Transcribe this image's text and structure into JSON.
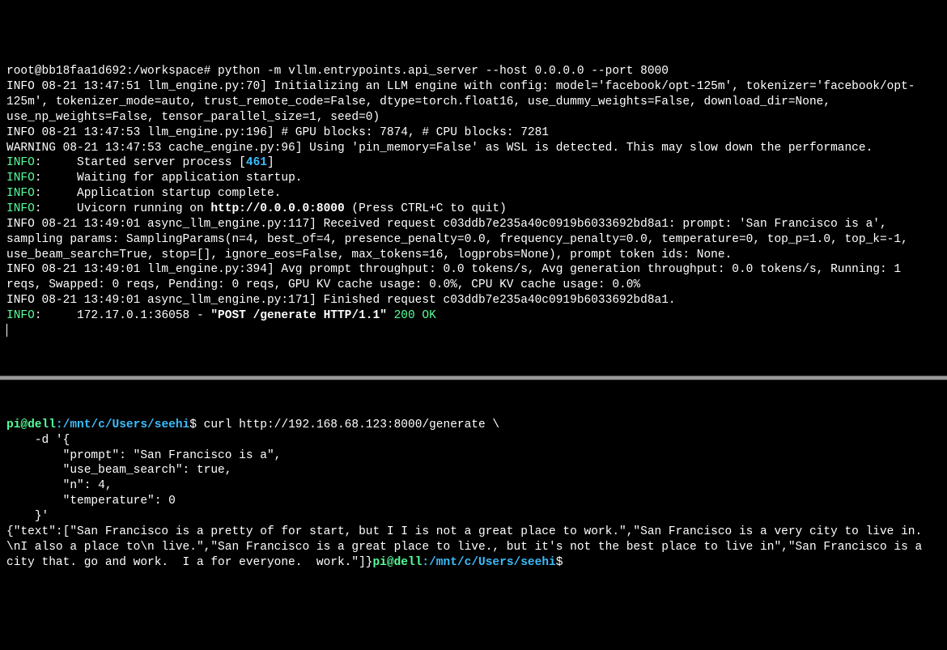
{
  "server": {
    "prompt_root": "root@bb18faa1d692",
    "prompt_path": ":/workspace#",
    "command": " python -m vllm.entrypoints.api_server --host 0.0.0.0 --port 8000",
    "line1": "INFO 08-21 13:47:51 llm_engine.py:70] Initializing an LLM engine with config: model='facebook/opt-125m', tokenizer='facebook/opt-125m', tokenizer_mode=auto, trust_remote_code=False, dtype=torch.float16, use_dummy_weights=False, download_dir=None, use_np_weights=False, tensor_parallel_size=1, seed=0)",
    "line2": "INFO 08-21 13:47:53 llm_engine.py:196] # GPU blocks: 7874, # CPU blocks: 7281",
    "line3": "WARNING 08-21 13:47:53 cache_engine.py:96] Using 'pin_memory=False' as WSL is detected. This may slow down the performance.",
    "info_label": "INFO",
    "colon": ":",
    "pad": "     ",
    "started_pre": "Started server process [",
    "pid": "461",
    "started_post": "]",
    "waiting": "Waiting for application startup.",
    "complete": "Application startup complete.",
    "uvicorn_pre": "Uvicorn running on ",
    "uvicorn_url": "http://0.0.0.0:8000",
    "uvicorn_post": " (Press CTRL+C to quit)",
    "line4": "INFO 08-21 13:49:01 async_llm_engine.py:117] Received request c03ddb7e235a40c0919b6033692bd8a1: prompt: 'San Francisco is a', sampling params: SamplingParams(n=4, best_of=4, presence_penalty=0.0, frequency_penalty=0.0, temperature=0, top_p=1.0, top_k=-1, use_beam_search=True, stop=[], ignore_eos=False, max_tokens=16, logprobs=None), prompt token ids: None.",
    "line5": "INFO 08-21 13:49:01 llm_engine.py:394] Avg prompt throughput: 0.0 tokens/s, Avg generation throughput: 0.0 tokens/s, Running: 1 reqs, Swapped: 0 reqs, Pending: 0 reqs, GPU KV cache usage: 0.0%, CPU KV cache usage: 0.0%",
    "line6": "INFO 08-21 13:49:01 async_llm_engine.py:171] Finished request c03ddb7e235a40c0919b6033692bd8a1.",
    "access_ip": "172.17.0.1:36058 - ",
    "access_req": "\"POST /generate HTTP/1.1\"",
    "access_status": " 200 OK"
  },
  "client": {
    "user": "pi@dell",
    "path": ":/mnt/c/Users/seehi",
    "dollar": "$",
    "cmd0": " curl http://192.168.68.123:8000/generate \\",
    "cmd1": "    -d '{",
    "cmd2": "        \"prompt\": \"San Francisco is a\",",
    "cmd3": "        \"use_beam_search\": true,",
    "cmd4": "        \"n\": 4,",
    "cmd5": "        \"temperature\": 0",
    "cmd6": "    }'",
    "response": "{\"text\":[\"San Francisco is a pretty of for start, but I I is not a great place to work.\",\"San Francisco is a very city to live in. \\nI also a place to\\n live.\",\"San Francisco is a great place to live., but it's not the best place to live in\",\"San Francisco is a city that. go and work.  I a for everyone.  work.\"]}"
  }
}
